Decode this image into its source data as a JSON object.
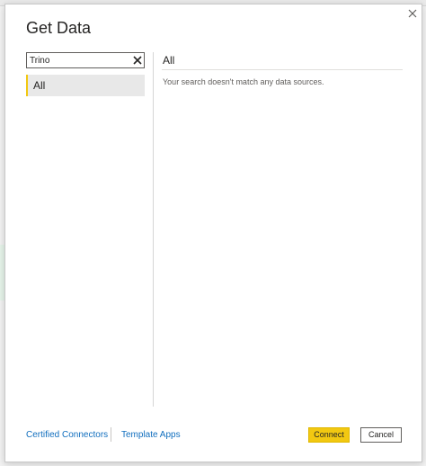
{
  "dialog": {
    "title": "Get Data",
    "close_icon": "close-icon"
  },
  "search": {
    "value": "Trino",
    "clear_icon": "clear-x-icon"
  },
  "categories": [
    {
      "label": "All",
      "selected": true
    }
  ],
  "results": {
    "section_title": "All",
    "empty_message": "Your search doesn't match any data sources."
  },
  "footer": {
    "certified_connectors": "Certified Connectors",
    "template_apps": "Template Apps",
    "connect_label": "Connect",
    "cancel_label": "Cancel"
  },
  "colors": {
    "accent": "#f2c811",
    "link": "#106ebe",
    "selected_bg": "#e8e8e8"
  }
}
